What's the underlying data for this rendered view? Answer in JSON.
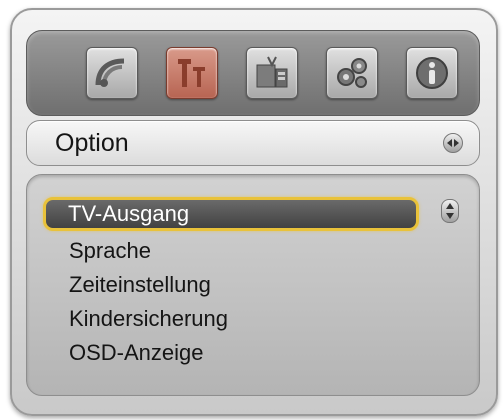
{
  "header": {
    "icons": [
      {
        "name": "satellite-dish-icon",
        "active": false
      },
      {
        "name": "text-settings-icon",
        "active": true
      },
      {
        "name": "tv-setup-icon",
        "active": false
      },
      {
        "name": "gears-icon",
        "active": false
      },
      {
        "name": "info-icon",
        "active": false
      }
    ],
    "title": "Option"
  },
  "menu": {
    "items": [
      "TV-Ausgang",
      "Sprache",
      "Zeiteinstellung",
      "Kindersicherung",
      "OSD-Anzeige"
    ],
    "selected_index": 0
  },
  "colors": {
    "highlight_border": "#e9c23a",
    "highlight_fill": "#4f4f4f",
    "active_icon": "#c07060"
  }
}
